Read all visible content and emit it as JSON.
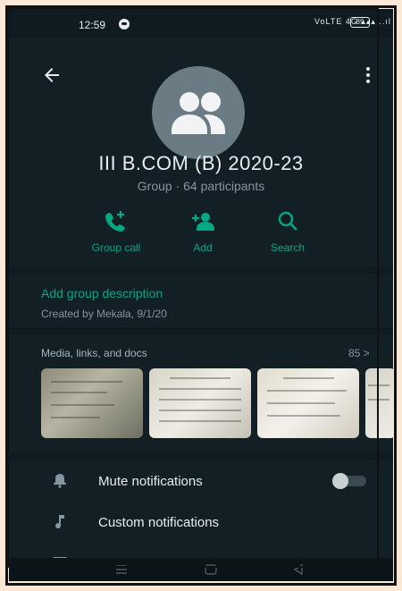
{
  "status_bar": {
    "time": "12:59",
    "signal_text": "VoLTE 4G ▴▴▴ ..ıl",
    "battery": "89"
  },
  "header": {
    "group_name": "III B.COM (B) 2020-23",
    "subtitle": "Group · 64 participants",
    "actions": [
      {
        "label": "Group call",
        "icon": "group-call-icon"
      },
      {
        "label": "Add",
        "icon": "add-participant-icon"
      },
      {
        "label": "Search",
        "icon": "search-icon"
      }
    ]
  },
  "description": {
    "add_label": "Add group description",
    "created": "Created by Mekala, 9/1/20"
  },
  "media": {
    "title": "Media, links, and docs",
    "count": "85 >"
  },
  "settings": [
    {
      "label": "Mute notifications",
      "icon": "bell-icon"
    },
    {
      "label": "Custom notifications",
      "icon": "music-note-icon"
    }
  ],
  "colors": {
    "accent": "#00a884",
    "background": "#0f1b20",
    "panel": "#121f25"
  }
}
